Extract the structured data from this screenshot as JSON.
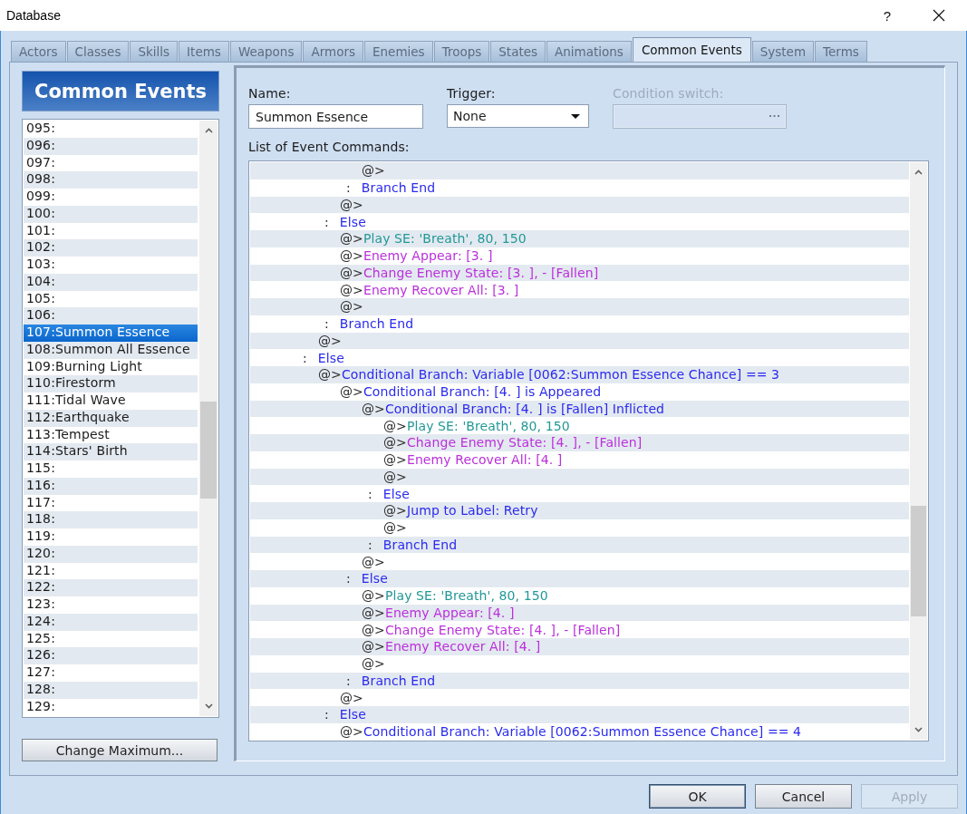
{
  "window": {
    "title": "Database",
    "help_label": "?"
  },
  "tabs": [
    {
      "label": "Actors",
      "selected": false
    },
    {
      "label": "Classes",
      "selected": false
    },
    {
      "label": "Skills",
      "selected": false
    },
    {
      "label": "Items",
      "selected": false
    },
    {
      "label": "Weapons",
      "selected": false
    },
    {
      "label": "Armors",
      "selected": false
    },
    {
      "label": "Enemies",
      "selected": false
    },
    {
      "label": "Troops",
      "selected": false
    },
    {
      "label": "States",
      "selected": false
    },
    {
      "label": "Animations",
      "selected": false
    },
    {
      "label": "Common Events",
      "selected": true
    },
    {
      "label": "System",
      "selected": false
    },
    {
      "label": "Terms",
      "selected": false
    }
  ],
  "sidebar": {
    "title": "Common Events",
    "items": [
      {
        "label": "095:",
        "selected": false
      },
      {
        "label": "096:",
        "selected": false
      },
      {
        "label": "097:",
        "selected": false
      },
      {
        "label": "098:",
        "selected": false
      },
      {
        "label": "099:",
        "selected": false
      },
      {
        "label": "100:",
        "selected": false
      },
      {
        "label": "101:",
        "selected": false
      },
      {
        "label": "102:",
        "selected": false
      },
      {
        "label": "103:",
        "selected": false
      },
      {
        "label": "104:",
        "selected": false
      },
      {
        "label": "105:",
        "selected": false
      },
      {
        "label": "106:",
        "selected": false
      },
      {
        "label": "107:Summon Essence",
        "selected": true
      },
      {
        "label": "108:Summon All Essence",
        "selected": false
      },
      {
        "label": "109:Burning Light",
        "selected": false
      },
      {
        "label": "110:Firestorm",
        "selected": false
      },
      {
        "label": "111:Tidal Wave",
        "selected": false
      },
      {
        "label": "112:Earthquake",
        "selected": false
      },
      {
        "label": "113:Tempest",
        "selected": false
      },
      {
        "label": "114:Stars' Birth",
        "selected": false
      },
      {
        "label": "115:",
        "selected": false
      },
      {
        "label": "116:",
        "selected": false
      },
      {
        "label": "117:",
        "selected": false
      },
      {
        "label": "118:",
        "selected": false
      },
      {
        "label": "119:",
        "selected": false
      },
      {
        "label": "120:",
        "selected": false
      },
      {
        "label": "121:",
        "selected": false
      },
      {
        "label": "122:",
        "selected": false
      },
      {
        "label": "123:",
        "selected": false
      },
      {
        "label": "124:",
        "selected": false
      },
      {
        "label": "125:",
        "selected": false
      },
      {
        "label": "126:",
        "selected": false
      },
      {
        "label": "127:",
        "selected": false
      },
      {
        "label": "128:",
        "selected": false
      },
      {
        "label": "129:",
        "selected": false
      }
    ],
    "change_maximum_button": "Change Maximum..."
  },
  "form": {
    "name": {
      "label": "Name:",
      "value": "Summon Essence"
    },
    "trigger": {
      "label": "Trigger:",
      "value": "None"
    },
    "condition_switch": {
      "label": "Condition switch:",
      "disabled": true
    }
  },
  "commands": {
    "label": "List of Event Commands:",
    "rows": [
      {
        "kind": "group",
        "children": [
          {
            "kind": "group",
            "children": [
              {
                "kind": "command",
                "prefix": "@>"
              },
              {
                "kind": "marker",
                "prefix": ":",
                "text": "Branch End",
                "color": "#2a2af0"
              }
            ]
          },
          {
            "kind": "command",
            "prefix": "@>"
          },
          {
            "kind": "marker",
            "prefix": ":",
            "text": "Else",
            "color": "#2a2af0"
          },
          {
            "kind": "command",
            "prefix": "@>",
            "text": "Play SE: 'Breath', 80, 150",
            "color": "#229898"
          },
          {
            "kind": "command",
            "prefix": "@>",
            "text": "Enemy Appear: [3. ]",
            "color": "#bb2fdc"
          },
          {
            "kind": "command",
            "prefix": "@>",
            "text": "Change Enemy State: [3. ], - [Fallen]",
            "color": "#bb2fdc"
          },
          {
            "kind": "command",
            "prefix": "@>",
            "text": "Enemy Recover All: [3. ]",
            "color": "#bb2fdc"
          },
          {
            "kind": "command",
            "prefix": "@>"
          },
          {
            "kind": "marker",
            "prefix": ":",
            "text": "Branch End",
            "color": "#2a2af0"
          }
        ]
      },
      {
        "kind": "command",
        "prefix": "@>"
      },
      {
        "kind": "marker",
        "prefix": ":",
        "text": "Else",
        "color": "#2a2af0"
      },
      {
        "kind": "command",
        "prefix": "@>",
        "text": "Conditional Branch: Variable [0062:Summon Essence Chance] == 3",
        "color": "#2a2af0",
        "children": [
          {
            "kind": "command",
            "prefix": "@>",
            "text": "Conditional Branch: [4. ] is Appeared",
            "color": "#2a2af0",
            "children": [
              {
                "kind": "command",
                "prefix": "@>",
                "text": "Conditional Branch: [4. ] is [Fallen] Inflicted",
                "color": "#2a2af0",
                "children": [
                  {
                    "kind": "command",
                    "prefix": "@>",
                    "text": "Play SE: 'Breath', 80, 150",
                    "color": "#229898"
                  },
                  {
                    "kind": "command",
                    "prefix": "@>",
                    "text": "Change Enemy State: [4. ], - [Fallen]",
                    "color": "#bb2fdc"
                  },
                  {
                    "kind": "command",
                    "prefix": "@>",
                    "text": "Enemy Recover All: [4. ]",
                    "color": "#bb2fdc"
                  },
                  {
                    "kind": "command",
                    "prefix": "@>"
                  },
                  {
                    "kind": "marker",
                    "prefix": ":",
                    "text": "Else",
                    "color": "#2a2af0"
                  },
                  {
                    "kind": "command",
                    "prefix": "@>",
                    "text": "Jump to Label: Retry",
                    "color": "#2a2af0"
                  },
                  {
                    "kind": "command",
                    "prefix": "@>"
                  },
                  {
                    "kind": "marker",
                    "prefix": ":",
                    "text": "Branch End",
                    "color": "#2a2af0"
                  }
                ]
              },
              {
                "kind": "command",
                "prefix": "@>"
              },
              {
                "kind": "marker",
                "prefix": ":",
                "text": "Else",
                "color": "#2a2af0"
              },
              {
                "kind": "command",
                "prefix": "@>",
                "text": "Play SE: 'Breath', 80, 150",
                "color": "#229898"
              },
              {
                "kind": "command",
                "prefix": "@>",
                "text": "Enemy Appear: [4. ]",
                "color": "#bb2fdc"
              },
              {
                "kind": "command",
                "prefix": "@>",
                "text": "Change Enemy State: [4. ], - [Fallen]",
                "color": "#bb2fdc"
              },
              {
                "kind": "command",
                "prefix": "@>",
                "text": "Enemy Recover All: [4. ]",
                "color": "#bb2fdc"
              },
              {
                "kind": "command",
                "prefix": "@>"
              },
              {
                "kind": "marker",
                "prefix": ":",
                "text": "Branch End",
                "color": "#2a2af0"
              }
            ]
          },
          {
            "kind": "command",
            "prefix": "@>"
          },
          {
            "kind": "marker",
            "prefix": ":",
            "text": "Else",
            "color": "#2a2af0"
          },
          {
            "kind": "command",
            "prefix": "@>",
            "text": "Conditional Branch: Variable [0062:Summon Essence Chance] == 4",
            "color": "#2a2af0"
          }
        ]
      }
    ]
  },
  "buttons": [
    {
      "label": "OK",
      "default": true,
      "disabled": false
    },
    {
      "label": "Cancel",
      "default": false,
      "disabled": false
    },
    {
      "label": "Apply",
      "default": false,
      "disabled": true
    }
  ]
}
